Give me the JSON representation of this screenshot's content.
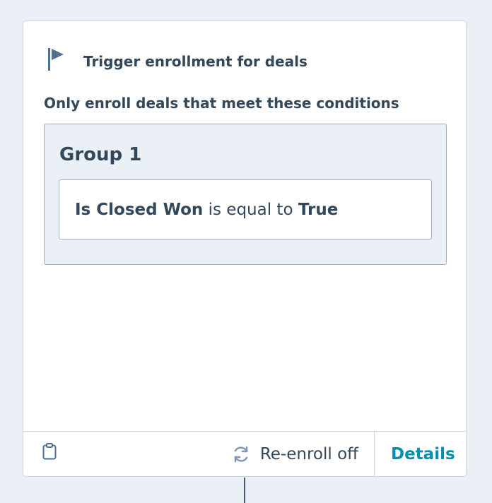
{
  "trigger": {
    "title": "Trigger enrollment for deals",
    "conditions_label": "Only enroll deals that meet these conditions",
    "icon": "flag-icon"
  },
  "group": {
    "title": "Group 1",
    "condition": {
      "property": "Is Closed Won",
      "operator": "is equal to",
      "value": "True"
    }
  },
  "footer": {
    "clipboard_icon": "clipboard-icon",
    "reenroll_icon": "refresh-icon",
    "reenroll_label": "Re-enroll off",
    "details_label": "Details"
  },
  "colors": {
    "background": "#eaf0f6",
    "text": "#33475b",
    "link": "#0091ae",
    "border": "#cbd6e2"
  }
}
